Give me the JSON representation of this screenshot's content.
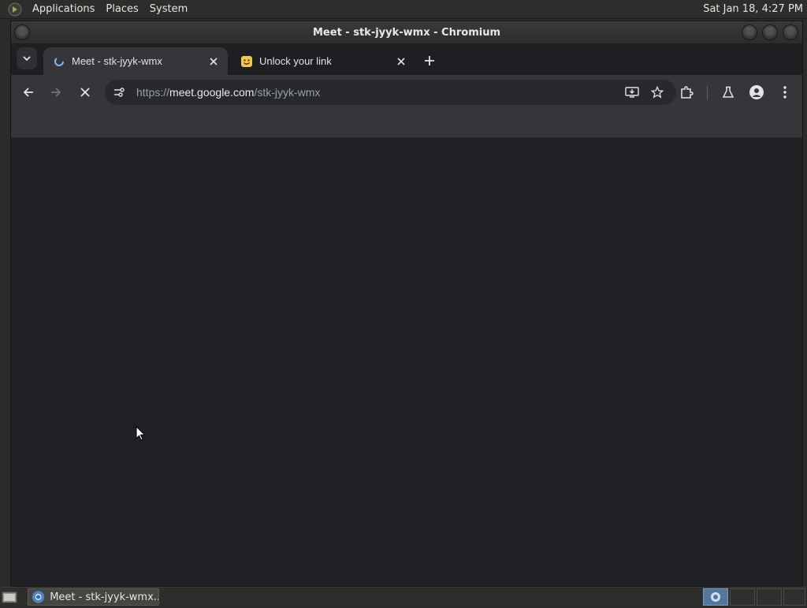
{
  "top_panel": {
    "menus": [
      "Applications",
      "Places",
      "System"
    ],
    "clock": "Sat Jan 18,  4:27 PM"
  },
  "window": {
    "title": "Meet - stk-jyyk-wmx - Chromium"
  },
  "tabs": [
    {
      "title": "Meet - stk-jyyk-wmx",
      "favicon": "meet-loading-icon",
      "active": true
    },
    {
      "title": "Unlock your link",
      "favicon": "smiley-face-icon",
      "active": false
    }
  ],
  "toolbar": {
    "url_scheme": "https://",
    "url_host": "meet.google.com",
    "url_path": "/stk-jyyk-wmx"
  },
  "taskbar": {
    "window_button_label": "Meet - stk-jyyk-wmx..."
  },
  "colors": {
    "content_bg": "#202124",
    "toolbar_bg": "#35363a",
    "panel_bg": "#2d2e2b"
  }
}
